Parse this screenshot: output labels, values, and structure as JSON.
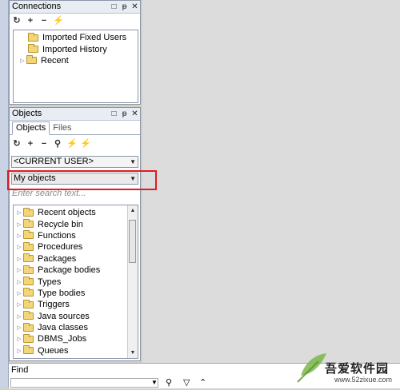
{
  "connections_panel": {
    "title": "Connections",
    "toolbar": {
      "refresh_icon": "refresh-icon",
      "add_icon": "add-icon",
      "remove_icon": "remove-icon",
      "connect_icon": "connect-icon"
    },
    "items": [
      {
        "label": "Imported Fixed Users",
        "expandable": false
      },
      {
        "label": "Imported History",
        "expandable": false
      },
      {
        "label": "Recent",
        "expandable": true
      }
    ]
  },
  "objects_panel": {
    "title": "Objects",
    "tabs": [
      "Objects",
      "Files"
    ],
    "user_selector": "<CURRENT USER>",
    "filter_selector": "My objects",
    "search_placeholder": "Enter search text...",
    "tree_items": [
      "Recent objects",
      "Recycle bin",
      "Functions",
      "Procedures",
      "Packages",
      "Package bodies",
      "Types",
      "Type bodies",
      "Triggers",
      "Java sources",
      "Java classes",
      "DBMS_Jobs",
      "Queues"
    ]
  },
  "find_bar": {
    "label": "Find"
  },
  "watermark": {
    "text": "吾爱软件园",
    "url": "www.52zixue.com"
  },
  "colors": {
    "highlight": "#e11b22",
    "folder": "#f3d67a",
    "panel_title_bg": "#e8ecf3"
  }
}
